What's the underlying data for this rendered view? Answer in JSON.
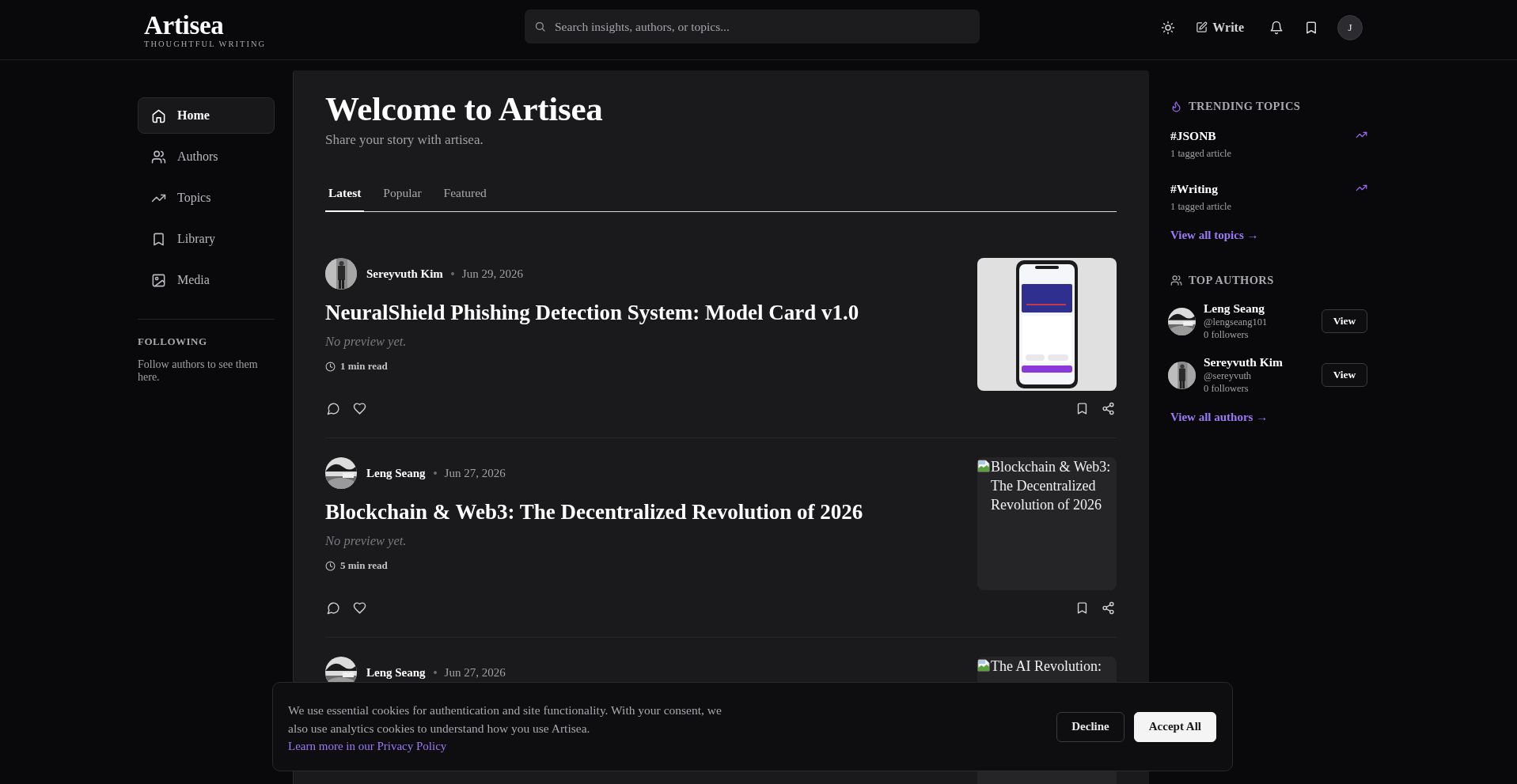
{
  "header": {
    "logo": {
      "title": "Artisea",
      "tagline": "THOUGHTFUL WRITING"
    },
    "search": {
      "placeholder": "Search insights, authors, or topics..."
    },
    "actions": [
      {
        "kind": "theme"
      },
      {
        "kind": "write",
        "label": "Write"
      },
      {
        "kind": "notifications"
      },
      {
        "kind": "bookmarks"
      },
      {
        "kind": "avatar",
        "label": "J"
      }
    ]
  },
  "sidebar": {
    "nav": [
      {
        "kind": "home",
        "label": "Home",
        "selected": true
      },
      {
        "kind": "authors",
        "label": "Authors",
        "selected": false
      },
      {
        "kind": "topics",
        "label": "Topics",
        "selected": false
      },
      {
        "kind": "library",
        "label": "Library",
        "selected": false
      },
      {
        "kind": "media",
        "label": "Media",
        "selected": false
      }
    ],
    "following": {
      "heading": "FOLLOWING",
      "text": "Follow authors to see them here."
    }
  },
  "main": {
    "title": "Welcome to Artisea",
    "subtitle": "Share your story with artisea.",
    "tabs": [
      {
        "label": "Latest",
        "selected": true
      },
      {
        "label": "Popular",
        "selected": false
      },
      {
        "label": "Featured",
        "selected": false
      }
    ],
    "articles": [
      {
        "author": "Sereyvuth Kim",
        "date": "Jun 29, 2026",
        "title": "NeuralShield Phishing Detection System: Model Card v1.0",
        "preview": "No preview yet.",
        "read_time": "1 min read"
      },
      {
        "author": "Leng Seang",
        "date": "Jun 27, 2026",
        "title": "Blockchain & Web3: The Decentralized Revolution of 2026",
        "preview": "No preview yet.",
        "read_time": "5 min read",
        "image": {
          "kind": "broken",
          "alt": "Blockchain & Web3: The Decentralized Revolution of 2026"
        }
      },
      {
        "author": "Leng Seang",
        "date": "Jun 27, 2026",
        "image": {
          "kind": "broken",
          "alt": "The AI Revolution:"
        }
      }
    ]
  },
  "right": {
    "trending": {
      "heading": "TRENDING TOPICS",
      "topics": [
        {
          "tag": "#JSONB",
          "count": "1 tagged article"
        },
        {
          "tag": "#Writing",
          "count": "1 tagged article"
        }
      ],
      "link": "View all topics →"
    },
    "authors": {
      "heading": "TOP AUTHORS",
      "items": [
        {
          "name": "Leng Seang",
          "handle": "@lengseang101",
          "followers": "0 followers",
          "button": "View"
        },
        {
          "name": "Sereyvuth Kim",
          "handle": "@sereyvuth",
          "followers": "0 followers",
          "button": "View"
        }
      ],
      "link": "View all authors →"
    }
  },
  "cookie": {
    "text": "We use essential cookies for authentication and site functionality. With your consent, we also use analytics cookies to understand how you use Artisea.",
    "link": "Learn more in our Privacy Policy",
    "buttons": [
      {
        "label": "Decline",
        "kind": "secondary"
      },
      {
        "label": "Accept All",
        "kind": "primary"
      }
    ]
  }
}
